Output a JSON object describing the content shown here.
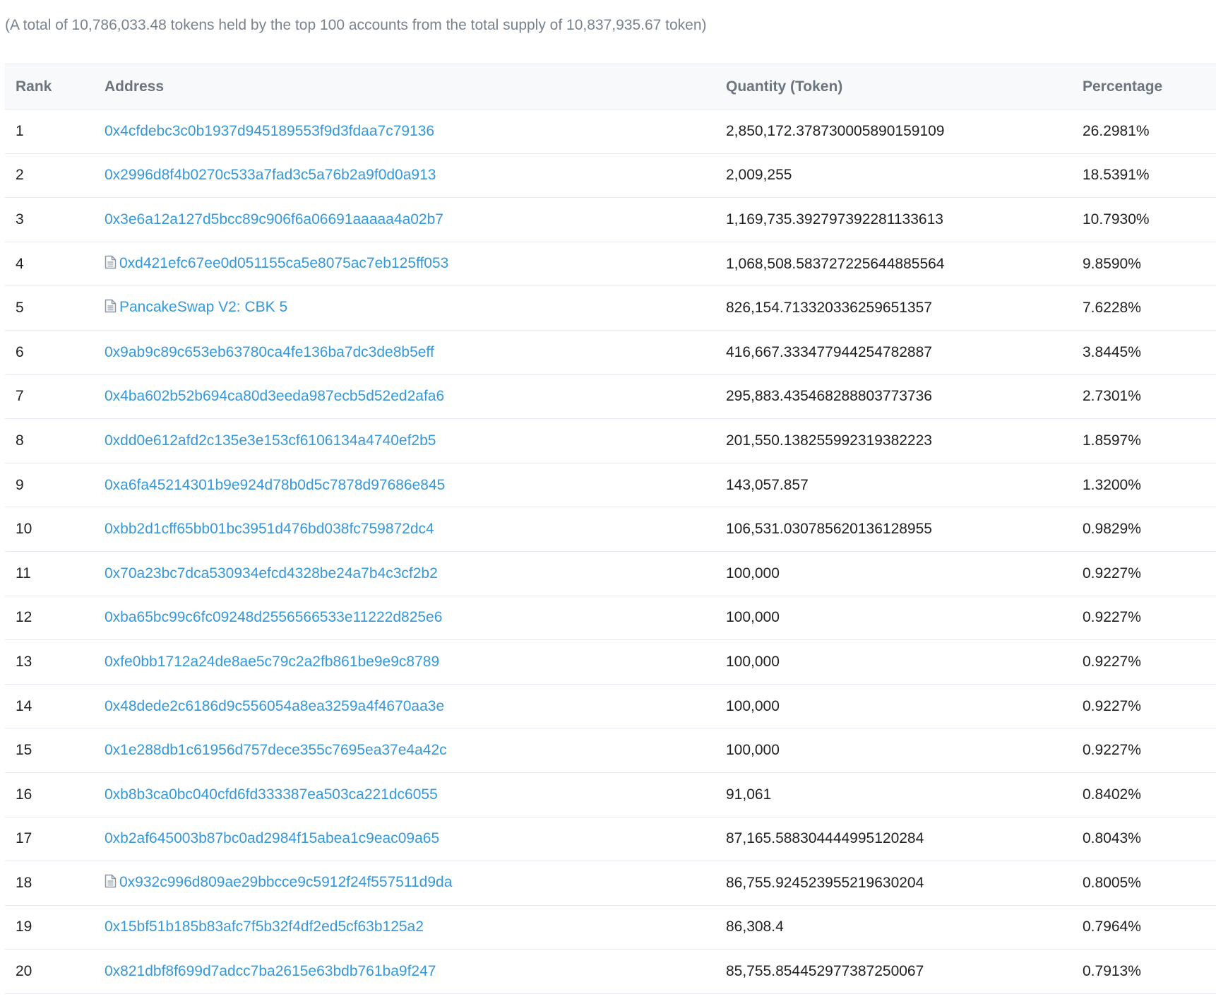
{
  "summary": "(A total of 10,786,033.48 tokens held by the top 100 accounts from the total supply of 10,837,935.67 token)",
  "table": {
    "headers": {
      "rank": "Rank",
      "address": "Address",
      "quantity": "Quantity (Token)",
      "percentage": "Percentage"
    },
    "rows": [
      {
        "rank": "1",
        "address": "0x4cfdebc3c0b1937d945189553f9d3fdaa7c79136",
        "contract": false,
        "quantity": "2,850,172.378730005890159109",
        "percentage": "26.2981%"
      },
      {
        "rank": "2",
        "address": "0x2996d8f4b0270c533a7fad3c5a76b2a9f0d0a913",
        "contract": false,
        "quantity": "2,009,255",
        "percentage": "18.5391%"
      },
      {
        "rank": "3",
        "address": "0x3e6a12a127d5bcc89c906f6a06691aaaaa4a02b7",
        "contract": false,
        "quantity": "1,169,735.392797392281133613",
        "percentage": "10.7930%"
      },
      {
        "rank": "4",
        "address": "0xd421efc67ee0d051155ca5e8075ac7eb125ff053",
        "contract": true,
        "quantity": "1,068,508.583727225644885564",
        "percentage": "9.8590%"
      },
      {
        "rank": "5",
        "address": "PancakeSwap V2: CBK 5",
        "contract": true,
        "quantity": "826,154.713320336259651357",
        "percentage": "7.6228%"
      },
      {
        "rank": "6",
        "address": "0x9ab9c89c653eb63780ca4fe136ba7dc3de8b5eff",
        "contract": false,
        "quantity": "416,667.333477944254782887",
        "percentage": "3.8445%"
      },
      {
        "rank": "7",
        "address": "0x4ba602b52b694ca80d3eeda987ecb5d52ed2afa6",
        "contract": false,
        "quantity": "295,883.435468288803773736",
        "percentage": "2.7301%"
      },
      {
        "rank": "8",
        "address": "0xdd0e612afd2c135e3e153cf6106134a4740ef2b5",
        "contract": false,
        "quantity": "201,550.138255992319382223",
        "percentage": "1.8597%"
      },
      {
        "rank": "9",
        "address": "0xa6fa45214301b9e924d78b0d5c7878d97686e845",
        "contract": false,
        "quantity": "143,057.857",
        "percentage": "1.3200%"
      },
      {
        "rank": "10",
        "address": "0xbb2d1cff65bb01bc3951d476bd038fc759872dc4",
        "contract": false,
        "quantity": "106,531.030785620136128955",
        "percentage": "0.9829%"
      },
      {
        "rank": "11",
        "address": "0x70a23bc7dca530934efcd4328be24a7b4c3cf2b2",
        "contract": false,
        "quantity": "100,000",
        "percentage": "0.9227%"
      },
      {
        "rank": "12",
        "address": "0xba65bc99c6fc09248d2556566533e11222d825e6",
        "contract": false,
        "quantity": "100,000",
        "percentage": "0.9227%"
      },
      {
        "rank": "13",
        "address": "0xfe0bb1712a24de8ae5c79c2a2fb861be9e9c8789",
        "contract": false,
        "quantity": "100,000",
        "percentage": "0.9227%"
      },
      {
        "rank": "14",
        "address": "0x48dede2c6186d9c556054a8ea3259a4f4670aa3e",
        "contract": false,
        "quantity": "100,000",
        "percentage": "0.9227%"
      },
      {
        "rank": "15",
        "address": "0x1e288db1c61956d757dece355c7695ea37e4a42c",
        "contract": false,
        "quantity": "100,000",
        "percentage": "0.9227%"
      },
      {
        "rank": "16",
        "address": "0xb8b3ca0bc040cfd6fd333387ea503ca221dc6055",
        "contract": false,
        "quantity": "91,061",
        "percentage": "0.8402%"
      },
      {
        "rank": "17",
        "address": "0xb2af645003b87bc0ad2984f15abea1c9eac09a65",
        "contract": false,
        "quantity": "87,165.588304444995120284",
        "percentage": "0.8043%"
      },
      {
        "rank": "18",
        "address": "0x932c996d809ae29bbcce9c5912f24f557511d9da",
        "contract": true,
        "quantity": "86,755.924523955219630204",
        "percentage": "0.8005%"
      },
      {
        "rank": "19",
        "address": "0x15bf51b185b83afc7f5b32f4df2ed5cf63b125a2",
        "contract": false,
        "quantity": "86,308.4",
        "percentage": "0.7964%"
      },
      {
        "rank": "20",
        "address": "0x821dbf8f699d7adcc7ba2615e63bdb761ba9f247",
        "contract": false,
        "quantity": "85,755.854452977387250067",
        "percentage": "0.7913%"
      }
    ]
  },
  "colors": {
    "link": "#3498db",
    "muted_text": "#77838f",
    "header_text": "#6c757e",
    "body_text": "#1e2022",
    "border": "#e7eaf3",
    "header_bg": "#f8f9fa"
  },
  "icons": {
    "contract": "file-document-icon"
  }
}
